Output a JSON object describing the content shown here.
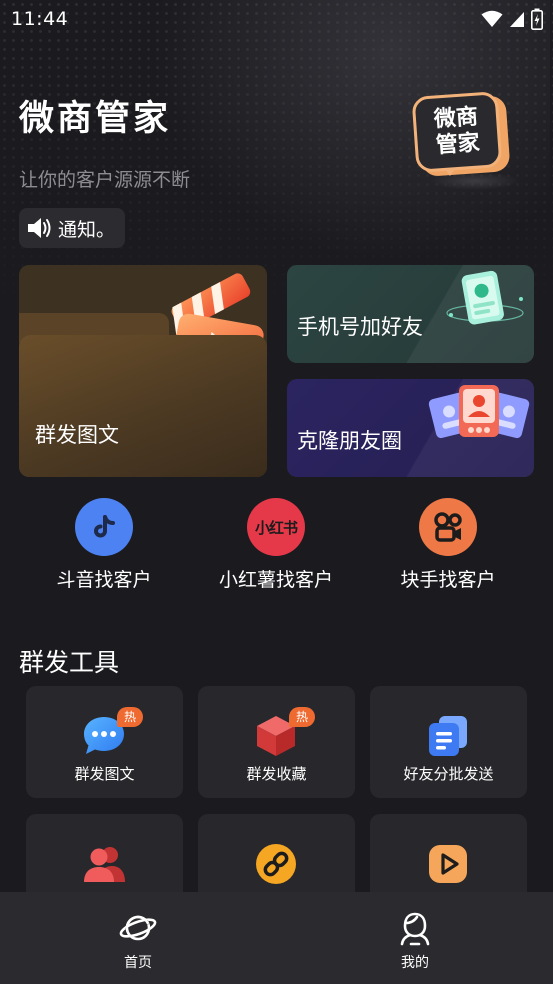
{
  "status_bar": {
    "time": "11:44"
  },
  "header": {
    "title": "微商管家",
    "subtitle": "让你的客户源源不断",
    "logo_line1": "微商",
    "logo_line2": "管家"
  },
  "notice": {
    "label": "通知。"
  },
  "feature_cards": {
    "mass_post": "群发图文",
    "phone_add": "手机号加好友",
    "clone_moments": "克隆朋友圈"
  },
  "platforms": [
    {
      "label": "斗音找客户",
      "icon": "douyin-icon",
      "color": "#4d82f2"
    },
    {
      "label": "小红薯找客户",
      "icon": "xiaohongshu-icon",
      "color": "#e5394a",
      "badge_text": "小红书"
    },
    {
      "label": "块手找客户",
      "icon": "kuaishou-icon",
      "color": "#ee7846"
    }
  ],
  "section": {
    "title": "群发工具"
  },
  "tools": [
    {
      "label": "群发图文",
      "icon": "chat-bubble-icon",
      "hot": "热"
    },
    {
      "label": "群发收藏",
      "icon": "box-icon",
      "hot": "热"
    },
    {
      "label": "好友分批发送",
      "icon": "copy-list-icon"
    },
    {
      "label": "",
      "icon": "users-icon"
    },
    {
      "label": "",
      "icon": "link-icon"
    },
    {
      "label": "",
      "icon": "video-play-icon"
    }
  ],
  "bottom_nav": [
    {
      "label": "首页",
      "icon": "planet-icon"
    },
    {
      "label": "我的",
      "icon": "profile-icon"
    }
  ],
  "colors": {
    "background": "#1b1b1f",
    "card_surface": "#28282c",
    "accent_orange": "#ef6a31",
    "douyin_blue": "#4d82f2",
    "xiaohongshu_red": "#e5394a",
    "kuaishou_orange": "#ee7846"
  }
}
